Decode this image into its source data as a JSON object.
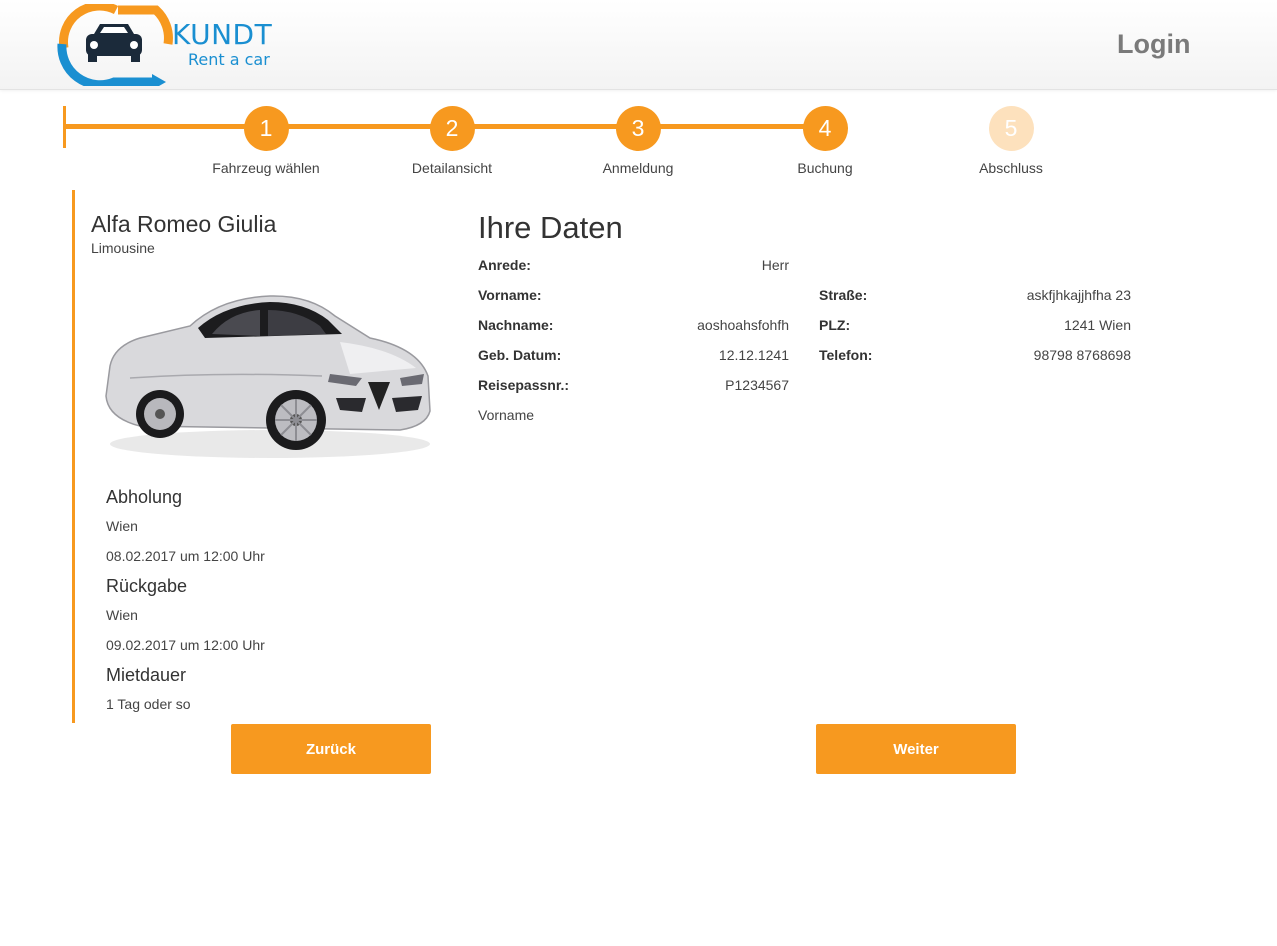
{
  "header": {
    "logo_text_1": "KUNDT",
    "logo_text_2": "Rent a car",
    "login_label": "Login"
  },
  "steps": [
    {
      "number": "1",
      "label": "Fahrzeug wählen",
      "state": "done"
    },
    {
      "number": "2",
      "label": "Detailansicht",
      "state": "done"
    },
    {
      "number": "3",
      "label": "Anmeldung",
      "state": "done"
    },
    {
      "number": "4",
      "label": "Buchung",
      "state": "current"
    },
    {
      "number": "5",
      "label": "Abschluss",
      "state": "inactive"
    }
  ],
  "car": {
    "name": "Alfa Romeo Giulia",
    "type": "Limousine"
  },
  "pickup": {
    "heading": "Abholung",
    "location": "Wien",
    "datetime": "08.02.2017 um 12:00 Uhr"
  },
  "return": {
    "heading": "Rückgabe",
    "location": "Wien",
    "datetime": "09.02.2017 um 12:00 Uhr"
  },
  "duration": {
    "heading": "Mietdauer",
    "value": "1 Tag oder so"
  },
  "user_data": {
    "title": "Ihre Daten",
    "anrede_label": "Anrede:",
    "anrede_value": "Herr",
    "vorname_label": "Vorname:",
    "vorname_value": "",
    "nachname_label": "Nachname:",
    "nachname_value": "aoshoahsfohfh",
    "geb_label": "Geb. Datum:",
    "geb_value": "12.12.1241",
    "reisepass_label": "Reisepassnr.:",
    "reisepass_value": "P1234567",
    "extra_text": "Vorname",
    "strasse_label": "Straße:",
    "strasse_value": "askfjhkajjhfha 23",
    "plz_label": "PLZ:",
    "plz_value": "1241 Wien",
    "telefon_label": "Telefon:",
    "telefon_value": "98798 8768698"
  },
  "buttons": {
    "back_label": "Zurück",
    "next_label": "Weiter"
  },
  "colors": {
    "accent": "#f7991f",
    "accent_light": "#fde1bd",
    "brand_blue": "#1a8fd1"
  }
}
